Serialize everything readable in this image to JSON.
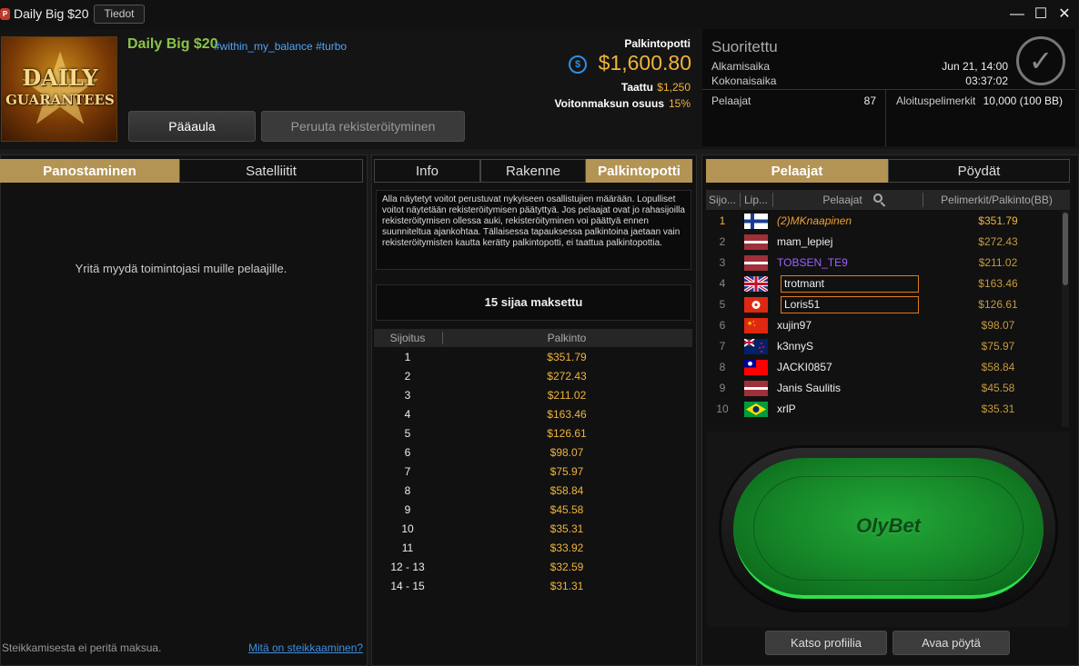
{
  "window": {
    "title": "Daily Big $20",
    "info_button": "Tiedot",
    "logo_text": "P"
  },
  "header": {
    "logo_words": [
      "DAILY",
      "GUARANTEES"
    ],
    "tournament_name": "Daily Big $20",
    "tags": "#within_my_balance #turbo",
    "main_lobby_button": "Pääaula",
    "unregister_button": "Peruuta rekisteröityminen",
    "prize_pool_label": "Palkintopotti",
    "prize_pool_value": "$1,600.80",
    "guaranteed_label": "Taattu",
    "guaranteed_value": "$1,250",
    "paid_share_label": "Voitonmaksun osuus",
    "paid_share_value": "15%"
  },
  "status": {
    "title": "Suoritettu",
    "start_label": "Alkamisaika",
    "start_value": "Jun 21, 14:00",
    "total_label": "Kokonaisaika",
    "total_value": "03:37:02",
    "players_label": "Pelaajat",
    "players_value": "87",
    "chips_label": "Aloituspelimerkit",
    "chips_value": "10,000 (100 BB)"
  },
  "left": {
    "tabs": [
      "Panostaminen",
      "Satelliitit"
    ],
    "message": "Yritä myydä toimintojasi muille pelaajille.",
    "footer_note": "Steikkamisesta ei peritä maksua.",
    "footer_link": "Mitä on steikkaaminen?"
  },
  "middle": {
    "tabs": [
      "Info",
      "Rakenne",
      "Palkintopotti"
    ],
    "notice": "Alla näytetyt voitot perustuvat nykyiseen osallistujien määrään. Lopulliset voitot näytetään rekisteröitymisen päätyttyä. Jos pelaajat ovat jo rahasijoilla rekisteröitymisen ollessa auki, rekisteröityminen voi päättyä ennen suunniteltua ajankohtaa. Tällaisessa tapauksessa palkintoina jaetaan vain rekisteröitymisten kautta kerätty palkintopotti, ei taattua palkintopottia.",
    "paid_places": "15 sijaa maksettu",
    "col_place": "Sijoitus",
    "col_prize": "Palkinto",
    "payouts": [
      {
        "place": "1",
        "prize": "$351.79"
      },
      {
        "place": "2",
        "prize": "$272.43"
      },
      {
        "place": "3",
        "prize": "$211.02"
      },
      {
        "place": "4",
        "prize": "$163.46"
      },
      {
        "place": "5",
        "prize": "$126.61"
      },
      {
        "place": "6",
        "prize": "$98.07"
      },
      {
        "place": "7",
        "prize": "$75.97"
      },
      {
        "place": "8",
        "prize": "$58.84"
      },
      {
        "place": "9",
        "prize": "$45.58"
      },
      {
        "place": "10",
        "prize": "$35.31"
      },
      {
        "place": "11",
        "prize": "$33.92"
      },
      {
        "place": "12 - 13",
        "prize": "$32.59"
      },
      {
        "place": "14 - 15",
        "prize": "$31.31"
      }
    ]
  },
  "right": {
    "tabs": [
      "Pelaajat",
      "Pöydät"
    ],
    "col_rank": "Sijo...",
    "col_flag": "Lip...",
    "col_player": "Pelaajat",
    "col_chips": "Pelimerkit/Palkinto(BB)",
    "players": [
      {
        "rank": "1",
        "flag": "finland",
        "name": "(2)MKnaapinen",
        "value": "$351.79"
      },
      {
        "rank": "2",
        "flag": "latvia",
        "name": "mam_lepiej",
        "value": "$272.43"
      },
      {
        "rank": "3",
        "flag": "latvia",
        "name": "TOBSEN_TE9",
        "value": "$211.02"
      },
      {
        "rank": "4",
        "flag": "uk",
        "name": "trotmant",
        "value": "$163.46"
      },
      {
        "rank": "5",
        "flag": "hongkong",
        "name": "Loris51",
        "value": "$126.61"
      },
      {
        "rank": "6",
        "flag": "china",
        "name": "xujin97",
        "value": "$98.07"
      },
      {
        "rank": "7",
        "flag": "newzealand",
        "name": "k3nnyS",
        "value": "$75.97"
      },
      {
        "rank": "8",
        "flag": "taiwan",
        "name": "JACKI0857",
        "value": "$58.84"
      },
      {
        "rank": "9",
        "flag": "latvia",
        "name": "Janis Saulitis",
        "value": "$45.58"
      },
      {
        "rank": "10",
        "flag": "brazil",
        "name": "xrlP",
        "value": "$35.31"
      }
    ],
    "table_brand": "OlyBet",
    "profile_button": "Katso profiilia",
    "open_table_button": "Avaa pöytä"
  },
  "colors": {
    "accent": "#b49455",
    "gold": "#f0b43c",
    "green": "#8bc34a",
    "link": "#3d8fe0"
  }
}
